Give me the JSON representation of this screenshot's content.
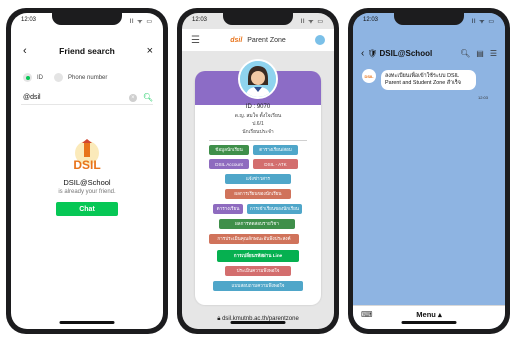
{
  "status": {
    "time": "12:03",
    "icons": "ll ᯤ ▭"
  },
  "phone1": {
    "header": {
      "back": "‹",
      "title": "Friend search",
      "close": "×"
    },
    "radios": {
      "id_label": "ID",
      "phone_label": "Phone number"
    },
    "search": {
      "value": "@dsil",
      "clear": "×",
      "icon": "search-icon"
    },
    "result": {
      "logo_text": "DSIL",
      "name": "DSIL@School",
      "subtitle": "is already your friend.",
      "chat_label": "Chat"
    },
    "colors": {
      "accent": "#06c755"
    }
  },
  "phone2": {
    "header": {
      "brand": "dsil",
      "zone": "Parent Zone"
    },
    "profile": {
      "id": "ID : 9070",
      "line1": "ด.ญ. สมใจ ตั้งใจเรียน",
      "line2": "ป.6/1",
      "line3": "นักเรียนประจำ"
    },
    "buttons": [
      {
        "label": "ข้อมูลนักเรียน",
        "color": "#3f8f4a"
      },
      {
        "label": "ตารางเรียน/สอบ",
        "color": "#4fa6c9"
      },
      {
        "label": "DSIL Account",
        "color": "#8e6bbf"
      },
      {
        "label": "DSIL - ATK",
        "color": "#d36e6e"
      },
      {
        "label": "แจ้งข่าวสาร",
        "color": "#4fa6c9"
      },
      {
        "label": "ผลการเรียนของนักเรียน",
        "color": "#d0735b"
      },
      {
        "label": "ตารางเรียน",
        "color": "#8e6bbf"
      },
      {
        "label": "การเข้าเรียนของนักเรียน",
        "color": "#4fa6c9"
      },
      {
        "label": "ผลการทดสอบรายวิชา",
        "color": "#3f8f4a"
      },
      {
        "label": "การประเมินคุณลักษณะอันพึงประสงค์",
        "color": "#d0735b"
      },
      {
        "label": "การเปลี่ยนรหัสผ่าน Line",
        "color": "#06b050"
      },
      {
        "label": "ประเมินความพึงพอใจ",
        "color": "#d36e6e"
      },
      {
        "label": "แบบสอบถามความพึงพอใจ",
        "color": "#4fa6c9"
      }
    ],
    "url": "dsil.kmutnb.ac.th/parentzone"
  },
  "phone3": {
    "header": {
      "back": "‹",
      "title": "DSIL@School",
      "icons": [
        "search-icon",
        "note-icon",
        "menu-icon"
      ]
    },
    "message": {
      "avatar_text": "DSIL",
      "text": "ลงทะเบียนเพื่อเข้าใช้ระบบ DSIL Parent and Student Zone สำเร็จ",
      "time": "12:03"
    },
    "menu": {
      "label": "Menu ▴"
    }
  }
}
